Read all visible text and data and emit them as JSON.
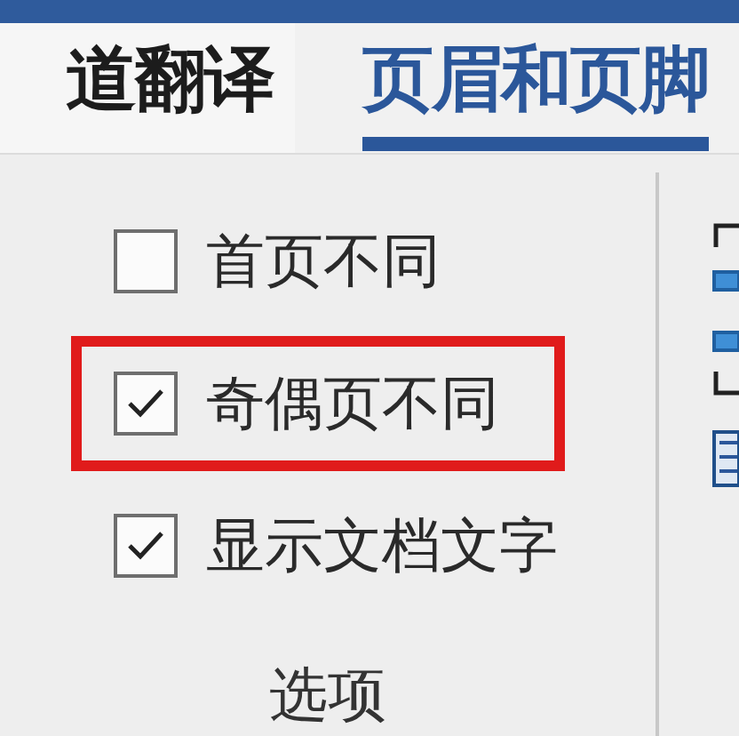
{
  "tabs": [
    {
      "label": "道翻译",
      "selected": false
    },
    {
      "label": "页眉和页脚",
      "selected": true
    }
  ],
  "options": [
    {
      "label": "首页不同",
      "checked": false,
      "highlighted": false
    },
    {
      "label": "奇偶页不同",
      "checked": true,
      "highlighted": true
    },
    {
      "label": "显示文档文字",
      "checked": true,
      "highlighted": false
    }
  ],
  "group_label": "选项"
}
